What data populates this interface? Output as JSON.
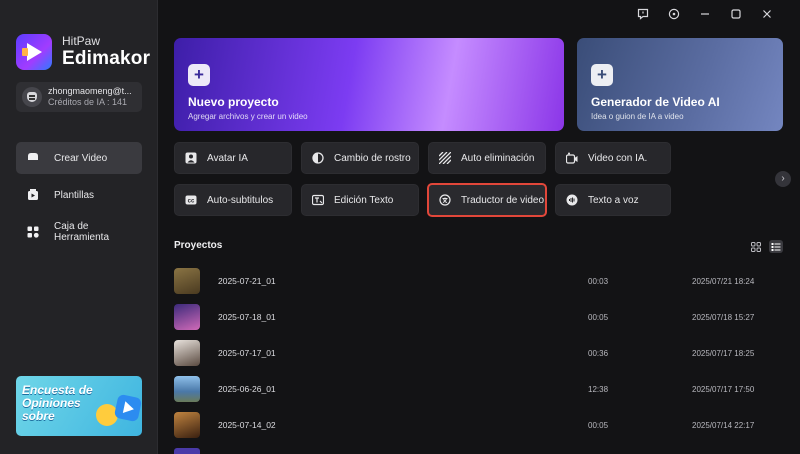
{
  "brand": {
    "sub": "HitPaw",
    "main": "Edimakor"
  },
  "user": {
    "name": "zhongmaomeng@t...",
    "credits": "Créditos de IA : 141"
  },
  "nav": [
    {
      "label": "Crear Video",
      "icon": "video-create-icon",
      "active": true
    },
    {
      "label": "Plantillas",
      "icon": "template-icon",
      "active": false
    },
    {
      "label": "Caja de Herramienta",
      "icon": "toolbox-icon",
      "active": false
    }
  ],
  "promo": {
    "text": "Encuesta de Opiniones sobre"
  },
  "window_controls": [
    "feedback-icon",
    "settings-icon",
    "minimize-icon",
    "maximize-icon",
    "close-icon"
  ],
  "hero": {
    "primary": {
      "title": "Nuevo proyecto",
      "subtitle": "Agregar archivos y crear un video",
      "plus": "+"
    },
    "secondary": {
      "title": "Generador de Video AI",
      "subtitle": "Idea o guion de IA a video",
      "plus": "+"
    }
  },
  "tools": [
    {
      "label": "Avatar IA",
      "icon": "avatar-icon"
    },
    {
      "label": "Cambio de rostro",
      "icon": "face-swap-icon"
    },
    {
      "label": "Auto eliminación",
      "icon": "auto-remove-icon"
    },
    {
      "label": "Video con IA.",
      "icon": "ai-video-icon"
    },
    {
      "label": "Auto-subtitulos",
      "icon": "subtitles-icon"
    },
    {
      "label": "Edición Texto",
      "icon": "text-edit-icon"
    },
    {
      "label": "Traductor de video",
      "icon": "translate-icon",
      "highlight": true
    },
    {
      "label": "Texto a voz",
      "icon": "text-to-speech-icon"
    }
  ],
  "projects": {
    "title": "Proyectos",
    "rows": [
      {
        "name": "2025-07-21_01",
        "duration": "00:03",
        "date": "2025/07/21 18:24",
        "thumb": "#6b5a34"
      },
      {
        "name": "2025-07-18_01",
        "duration": "00:05",
        "date": "2025/07/18 15:27",
        "thumb": "#7a4aa0"
      },
      {
        "name": "2025-07-17_01",
        "duration": "00:36",
        "date": "2025/07/17 18:25",
        "thumb": "#c9c2bc"
      },
      {
        "name": "2025-06-26_01",
        "duration": "12:38",
        "date": "2025/07/17 17:50",
        "thumb": "#5c88b8"
      },
      {
        "name": "2025-07-14_02",
        "duration": "00:05",
        "date": "2025/07/14 22:17",
        "thumb": "#8a5a2c"
      }
    ]
  },
  "colors": {
    "highlight": "#e2473a",
    "accent": "#7c3cf2"
  }
}
